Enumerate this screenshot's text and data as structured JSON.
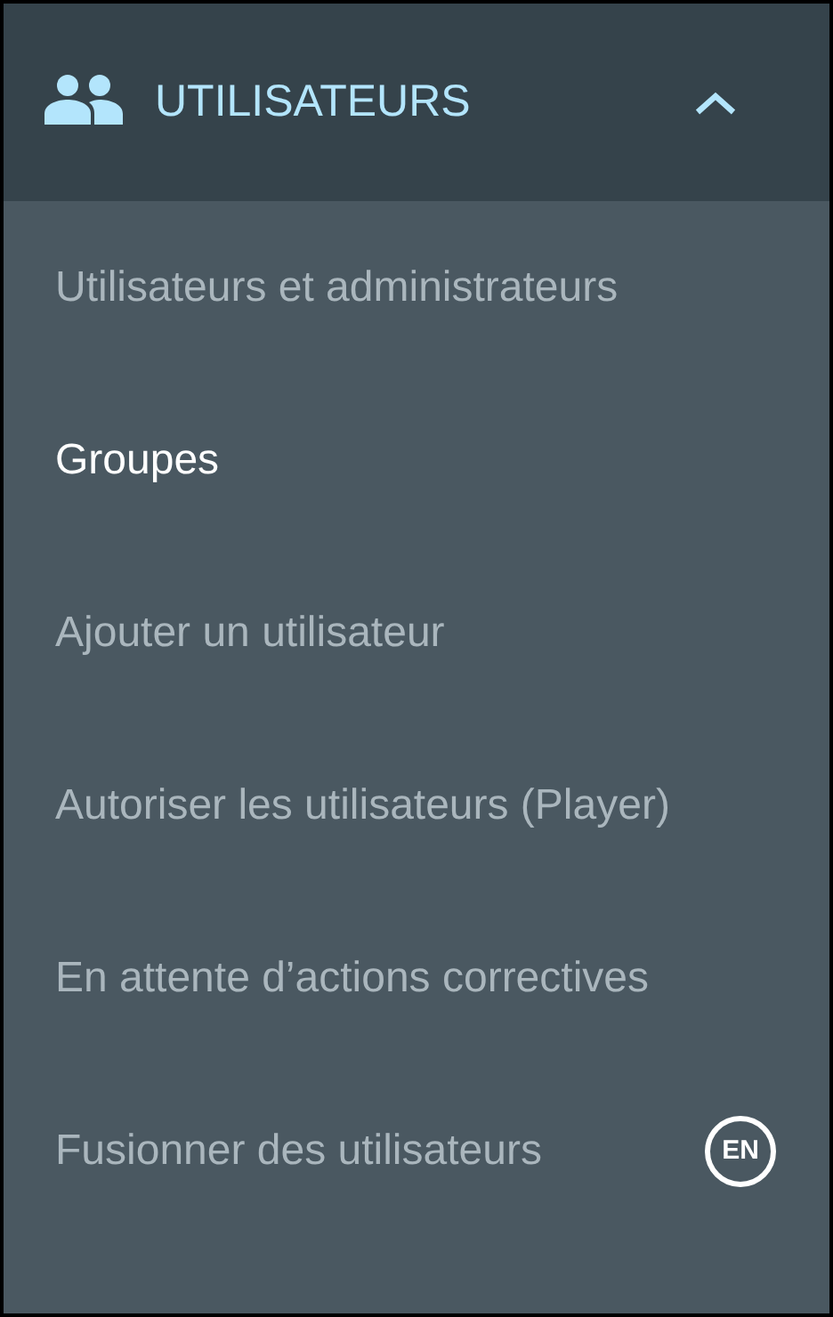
{
  "header": {
    "title": "UTILISATEURS",
    "expanded": true
  },
  "items": [
    {
      "label": "Utilisateurs et administrateurs",
      "selected": false
    },
    {
      "label": "Groupes",
      "selected": true
    },
    {
      "label": "Ajouter un utilisateur",
      "selected": false
    },
    {
      "label": "Autoriser les utilisateurs (Player)",
      "selected": false
    },
    {
      "label": "En attente d’actions correctives",
      "selected": false
    },
    {
      "label": "Fusionner des utilisateurs",
      "selected": false,
      "badge": "EN"
    }
  ]
}
